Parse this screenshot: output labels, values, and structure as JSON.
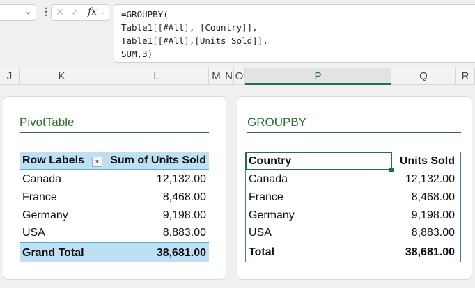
{
  "formula_bar": {
    "formula": "=GROUPBY(\nTable1[[#All], [Country]],\nTable1[[#All],[Units Sold]],\nSUM,3)",
    "fx": "fx"
  },
  "columns": [
    "J",
    "K",
    "L",
    "M",
    "N",
    "O",
    "P",
    "Q",
    "R"
  ],
  "pivot": {
    "title": "PivotTable",
    "header": [
      "Row Labels",
      "Sum of Units Sold"
    ],
    "rows": [
      [
        "Canada",
        "12,132.00"
      ],
      [
        "France",
        "8,468.00"
      ],
      [
        "Germany",
        "9,198.00"
      ],
      [
        "USA",
        "8,883.00"
      ]
    ],
    "total": [
      "Grand Total",
      "38,681.00"
    ]
  },
  "groupby": {
    "title": "GROUPBY",
    "header": [
      "Country",
      "Units Sold"
    ],
    "rows": [
      [
        "Canada",
        "12,132.00"
      ],
      [
        "France",
        "8,468.00"
      ],
      [
        "Germany",
        "9,198.00"
      ],
      [
        "USA",
        "8,883.00"
      ]
    ],
    "total": [
      "Total",
      "38,681.00"
    ]
  }
}
